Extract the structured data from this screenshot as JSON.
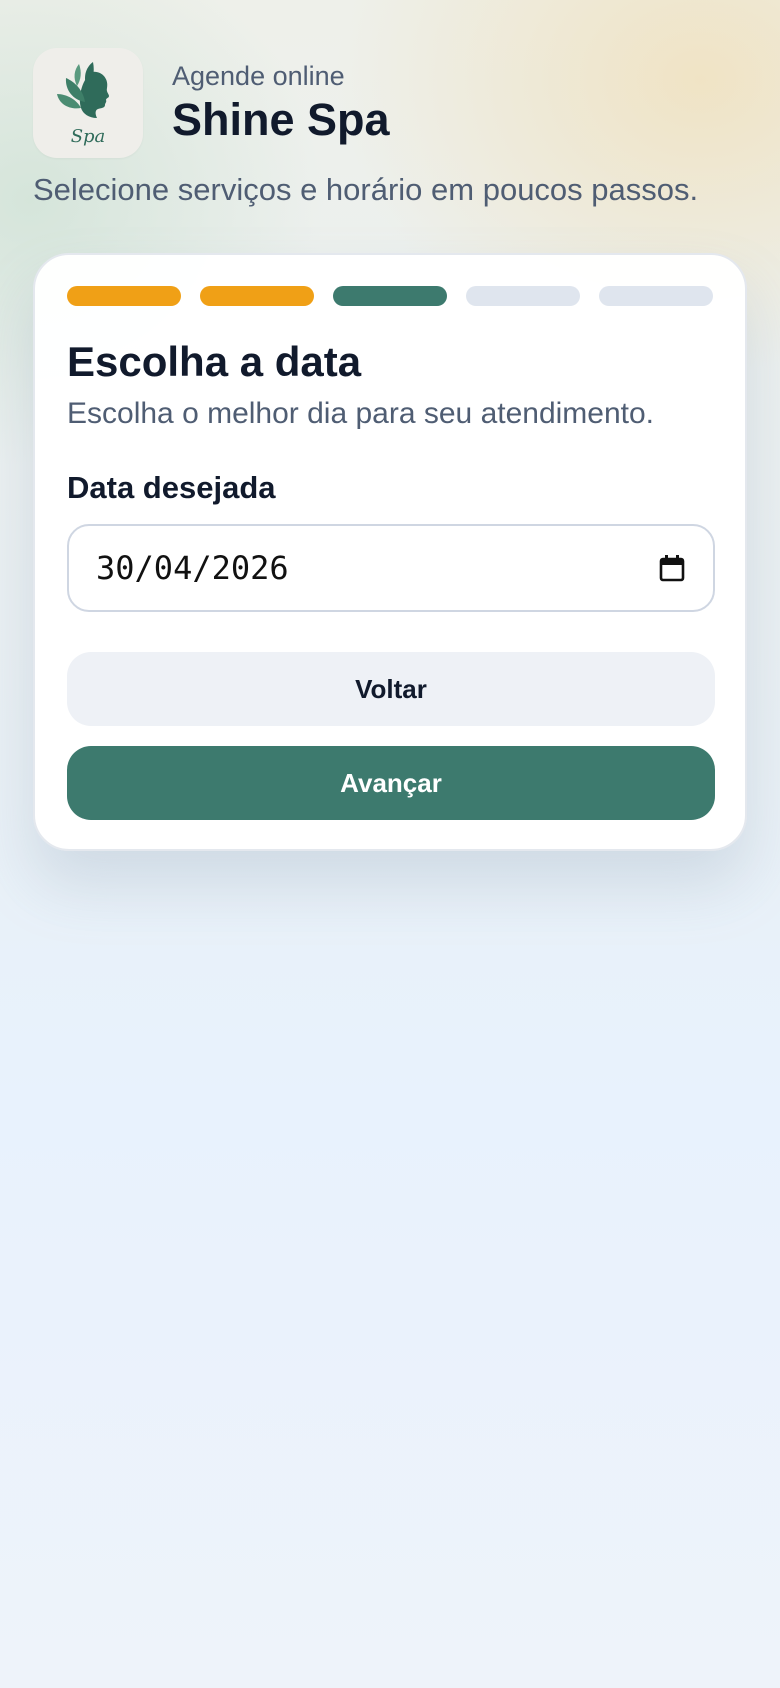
{
  "header": {
    "subtitle": "Agende online",
    "title": "Shine Spa",
    "logo_text": "Spa",
    "logo_icon": "leaf-face-icon"
  },
  "tagline": "Selecione serviços e horário em poucos passos.",
  "progress": {
    "total_steps": 5,
    "current_step": 3,
    "steps": [
      "done",
      "done",
      "current",
      "pending",
      "pending"
    ]
  },
  "card": {
    "title": "Escolha a data",
    "description": "Escolha o melhor dia para seu atendimento.",
    "date_label": "Data desejada",
    "date_value": "30/04/2026",
    "date_icon": "calendar-icon"
  },
  "buttons": {
    "back_label": "Voltar",
    "next_label": "Avançar"
  },
  "colors": {
    "accent": "#3d7a6e",
    "done": "#f0a016",
    "pending": "#dfe5ee",
    "text_dark": "#111a2c",
    "text_muted": "#4f5d73"
  }
}
